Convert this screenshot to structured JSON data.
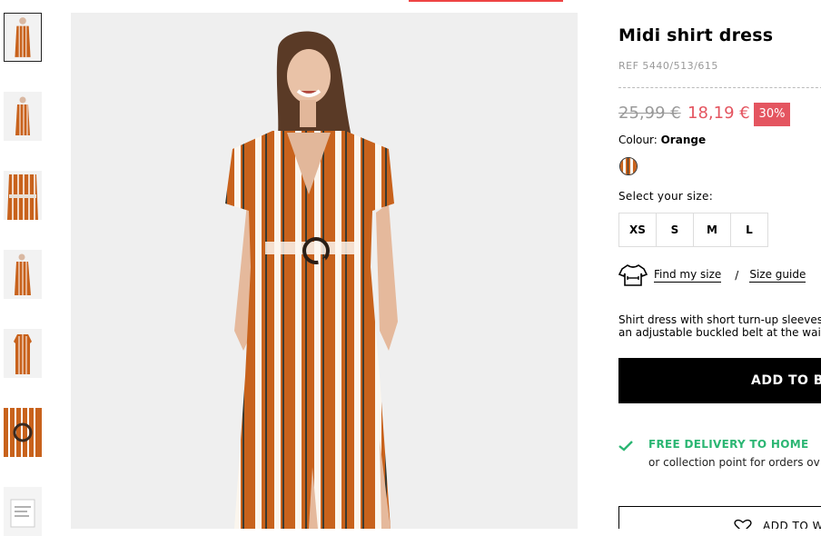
{
  "product": {
    "title": "Midi shirt dress",
    "ref": "REF 5440/513/615",
    "old_price": "25,99 €",
    "new_price": "18,19 €",
    "discount": "30%",
    "colour_label": "Colour:",
    "colour_value": "Orange",
    "size_prompt": "Select your size:",
    "sizes": [
      "XS",
      "S",
      "M",
      "L"
    ],
    "find_my_size": "Find my size",
    "separator": "/",
    "size_guide": "Size guide",
    "description_lines": [
      "Shirt dress with short turn-up sleeves.",
      "an adjustable buckled belt at the waist."
    ],
    "add_button": "ADD TO BA",
    "delivery_title": "FREE DELIVERY TO HOME",
    "delivery_sub": "or collection point for orders ov",
    "wishlist_label": "ADD TO WI"
  },
  "colors": {
    "accent_red": "#e45560",
    "delivery_green": "#2bb673",
    "dress_orange": "#c8621c"
  },
  "icons": [
    "shirt-size-icon",
    "checkmark-icon",
    "heart-icon"
  ]
}
